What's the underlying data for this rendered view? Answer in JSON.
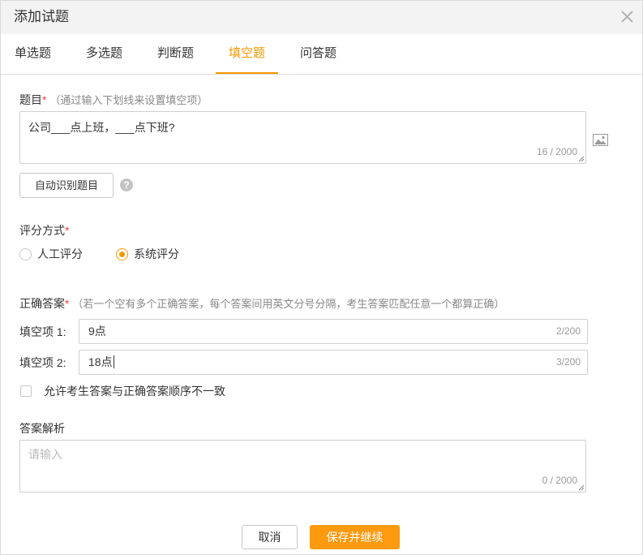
{
  "dialog": {
    "title": "添加试题",
    "close_icon": "close-icon"
  },
  "tabs": [
    {
      "label": "单选题",
      "active": false
    },
    {
      "label": "多选题",
      "active": false
    },
    {
      "label": "判断题",
      "active": false
    },
    {
      "label": "填空题",
      "active": true
    },
    {
      "label": "问答题",
      "active": false
    }
  ],
  "question": {
    "label": "题目",
    "required_mark": "*",
    "hint": "（通过输入下划线来设置填空项）",
    "value": "公司___点上班，___点下班?",
    "counter": "16 / 2000",
    "image_icon": "image-icon"
  },
  "auto_detect": {
    "label": "自动识别题目",
    "help_icon": "question-circle-icon",
    "help_glyph": "?"
  },
  "scoring": {
    "label": "评分方式",
    "required_mark": "*",
    "options": [
      {
        "label": "人工评分",
        "checked": false
      },
      {
        "label": "系统评分",
        "checked": true
      }
    ]
  },
  "answers": {
    "label": "正确答案",
    "required_mark": "*",
    "hint": "（若一个空有多个正确答案，每个答案间用英文分号分隔，考生答案匹配任意一个都算正确）",
    "items": [
      {
        "label": "填空项 1:",
        "value": "9点",
        "counter": "2/200"
      },
      {
        "label": "填空项 2:",
        "value": "18点",
        "counter": "3/200"
      }
    ],
    "order_option": {
      "label": "允许考生答案与正确答案顺序不一致",
      "checked": false
    }
  },
  "analysis": {
    "label": "答案解析",
    "placeholder": "请输入",
    "value": "",
    "counter": "0 / 2000"
  },
  "footer": {
    "cancel_label": "取消",
    "save_label": "保存并继续"
  },
  "colors": {
    "accent": "#f39800",
    "primary_button": "#fd9a0f",
    "required": "#f04134",
    "text": "#333333",
    "muted": "#999999",
    "border": "#cccccc"
  }
}
